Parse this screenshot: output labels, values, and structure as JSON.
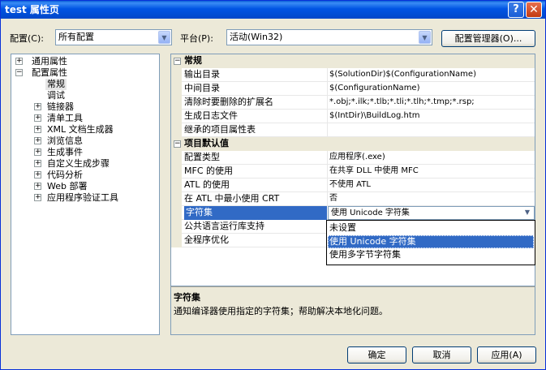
{
  "window": {
    "title": "test 属性页",
    "help_glyph": "?",
    "close_glyph": "✕"
  },
  "toolbar": {
    "config_label": "配置(C):",
    "config_value": "所有配置",
    "platform_label": "平台(P):",
    "platform_value": "活动(Win32)",
    "config_manager_label": "配置管理器(O)..."
  },
  "tree": {
    "items": [
      {
        "label": "通用属性",
        "expander": "+"
      },
      {
        "label": "配置属性",
        "expander": "−"
      },
      {
        "label": "常规",
        "expander": ""
      },
      {
        "label": "调试",
        "expander": ""
      },
      {
        "label": "链接器",
        "expander": "+"
      },
      {
        "label": "清单工具",
        "expander": "+"
      },
      {
        "label": "XML 文档生成器",
        "expander": "+"
      },
      {
        "label": "浏览信息",
        "expander": "+"
      },
      {
        "label": "生成事件",
        "expander": "+"
      },
      {
        "label": "自定义生成步骤",
        "expander": "+"
      },
      {
        "label": "代码分析",
        "expander": "+"
      },
      {
        "label": "Web 部署",
        "expander": "+"
      },
      {
        "label": "应用程序验证工具",
        "expander": "+"
      }
    ]
  },
  "grid": {
    "categories": [
      {
        "label": "常规",
        "expander": "−"
      },
      {
        "label": "项目默认值",
        "expander": "−"
      }
    ],
    "general_rows": [
      {
        "name": "输出目录",
        "value": "$(SolutionDir)$(ConfigurationName)"
      },
      {
        "name": "中间目录",
        "value": "$(ConfigurationName)"
      },
      {
        "name": "清除时要删除的扩展名",
        "value": "*.obj;*.ilk;*.tlb;*.tli;*.tlh;*.tmp;*.rsp;"
      },
      {
        "name": "生成日志文件",
        "value": "$(IntDir)\\BuildLog.htm"
      },
      {
        "name": "继承的项目属性表",
        "value": ""
      }
    ],
    "default_rows": [
      {
        "name": "配置类型",
        "value": "应用程序(.exe)"
      },
      {
        "name": "MFC 的使用",
        "value": "在共享 DLL 中使用 MFC"
      },
      {
        "name": "ATL 的使用",
        "value": "不使用 ATL"
      },
      {
        "name": "在 ATL 中最小使用 CRT",
        "value": "否"
      },
      {
        "name": "字符集",
        "value": "使用 Unicode 字符集"
      },
      {
        "name": "公共语言运行库支持",
        "value": ""
      },
      {
        "name": "全程序优化",
        "value": ""
      }
    ],
    "dropdown_options": [
      "未设置",
      "使用 Unicode 字符集",
      "使用多字节字符集"
    ],
    "selected_option": "使用 Unicode 字符集"
  },
  "description": {
    "title": "字符集",
    "text": "通知编译器使用指定的字符集；帮助解决本地化问题。"
  },
  "buttons": {
    "ok": "确定",
    "cancel": "取消",
    "apply": "应用(A)"
  },
  "colors": {
    "titlebar": "#0054e3",
    "selection": "#316ac5",
    "dialog_bg": "#ece9d8"
  }
}
